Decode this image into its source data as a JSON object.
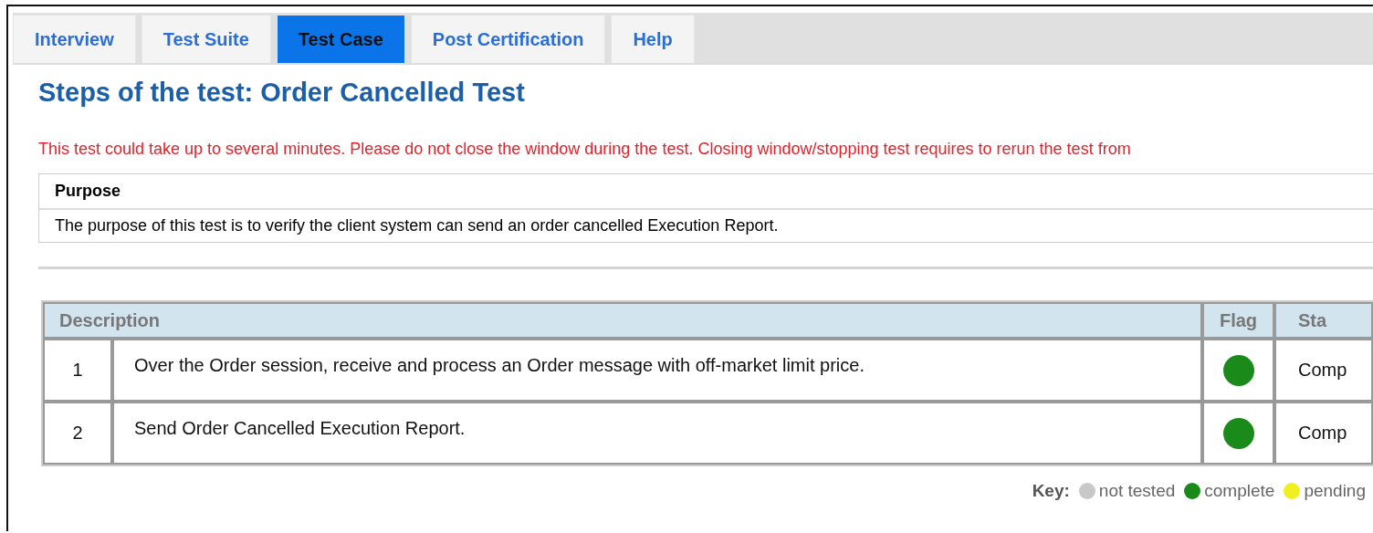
{
  "tabs": [
    {
      "label": "Interview",
      "selected": false
    },
    {
      "label": "Test Suite",
      "selected": false
    },
    {
      "label": "Test Case",
      "selected": true
    },
    {
      "label": "Post Certification",
      "selected": false
    },
    {
      "label": "Help",
      "selected": false
    }
  ],
  "heading": "Steps of the test: Order Cancelled Test",
  "warning": "This test could take up to several minutes. Please do not close the window during the test. Closing window/stopping test requires to rerun the test from",
  "purpose": {
    "title": "Purpose",
    "text": "The purpose of this test is to verify the client system can send an order cancelled Execution Report."
  },
  "table": {
    "columns": [
      "Description",
      "Flag",
      "Sta"
    ],
    "rows": [
      {
        "number": "1",
        "description": "Over the Order session, receive and process an Order message with off-market limit price.",
        "color": "#1a8a1a",
        "status": "Comp"
      },
      {
        "number": "2",
        "description": "Send Order Cancelled Execution Report.",
        "color": "#1a8a1a",
        "status": "Comp"
      }
    ]
  },
  "key": {
    "label": "Key:",
    "items": [
      {
        "label": "not tested",
        "color": "#c8c8c8"
      },
      {
        "label": "complete",
        "color": "#1a8a1a"
      },
      {
        "label": "pending",
        "color": "#f0f020"
      }
    ]
  }
}
